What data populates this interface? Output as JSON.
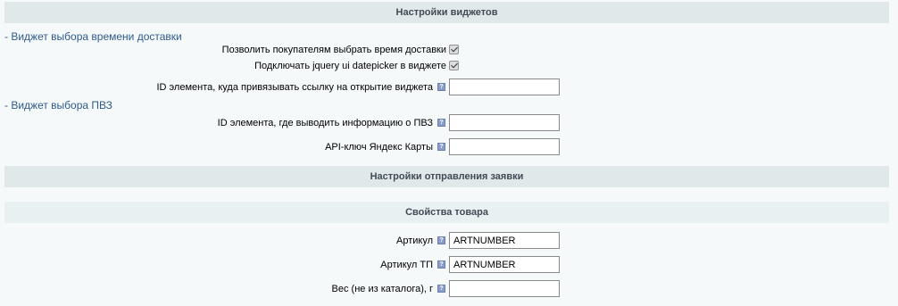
{
  "headings": {
    "widget_settings": "Настройки виджетов",
    "request_settings": "Настройки отправления заявки",
    "product_properties": "Свойства товара"
  },
  "sections": {
    "delivery_time_widget": "- Виджет выбора времени доставки",
    "pvz_widget": "- Виджет выбора ПВЗ"
  },
  "fields": {
    "allow_time_choice": {
      "label": "Позволить покупателям выбрать время доставки",
      "checked": true
    },
    "connect_datepicker": {
      "label": "Подключать jquery ui datepicker в виджете",
      "checked": true
    },
    "widget_link_element_id": {
      "label": "ID элемента, куда привязывать ссылку на открытие виджета",
      "value": ""
    },
    "pvz_info_element_id": {
      "label": "ID элемента, где выводить информацию о ПВЗ",
      "value": ""
    },
    "yandex_maps_api_key": {
      "label": "API-ключ Яндекс Карты",
      "value": ""
    },
    "article": {
      "label": "Артикул",
      "value": "ARTNUMBER"
    },
    "article_tp": {
      "label": "Артикул ТП",
      "value": "ARTNUMBER"
    },
    "weight": {
      "label": "Вес (не из каталога), г",
      "value": ""
    }
  },
  "icons": {
    "hint": "hint-icon",
    "checkbox": "checkbox"
  },
  "colors": {
    "heading_bg": "#e0e8ea",
    "link": "#2e5a8c",
    "page_bg": "#f5f9f9"
  }
}
